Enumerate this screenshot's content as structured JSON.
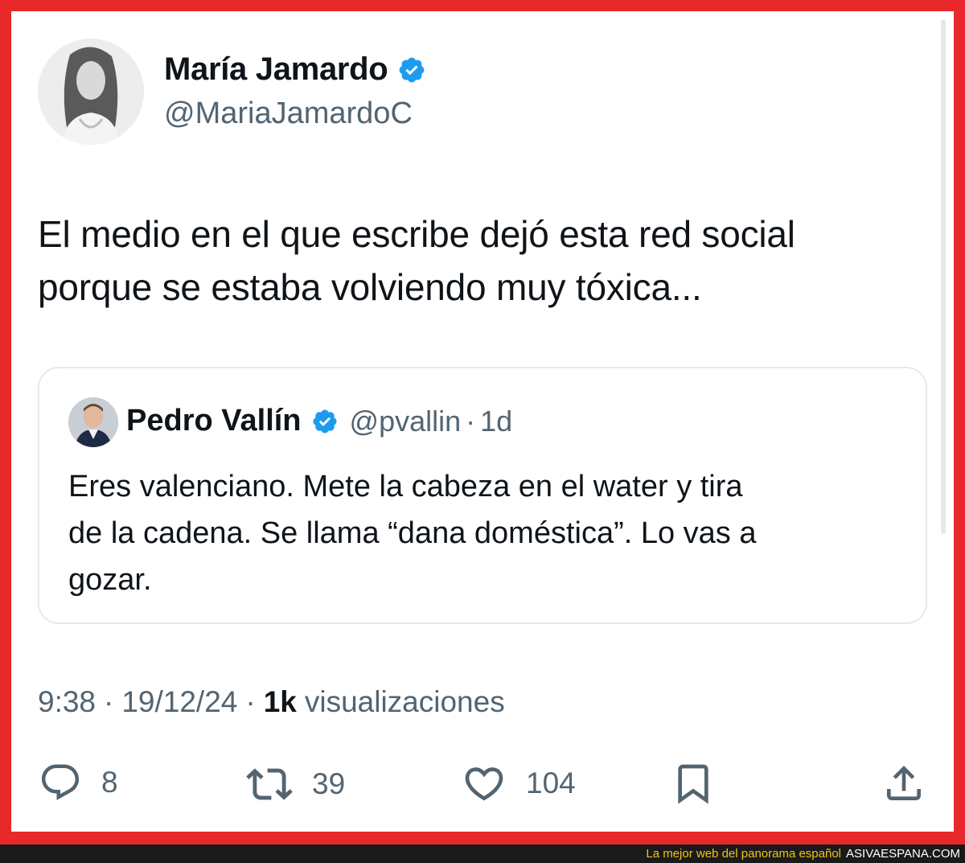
{
  "author": {
    "display_name": "María Jamardo",
    "handle": "@MariaJamardoC"
  },
  "tweet": {
    "text_line1": "El medio en el que escribe dejó esta red social",
    "text_line2": "porque se estaba volviendo muy tóxica..."
  },
  "quoted_tweet": {
    "display_name": "Pedro Vallín",
    "handle": "@pvallin",
    "separator": "·",
    "time": "1d",
    "text_line1": "Eres valenciano. Mete la cabeza en el water y tira",
    "text_line2": "de la cadena. Se llama “dana doméstica”. Lo vas a",
    "text_line3": "gozar."
  },
  "meta": {
    "time": "9:38",
    "separator": "·",
    "date": "19/12/24",
    "views_count": "1k",
    "views_label": "visualizaciones"
  },
  "actions": {
    "replies": "8",
    "reposts": "39",
    "likes": "104"
  },
  "icons": {
    "verified": "verified-badge-icon",
    "reply": "reply-icon",
    "repost": "repost-icon",
    "like": "heart-icon",
    "bookmark": "bookmark-icon",
    "share": "share-icon"
  },
  "footer": {
    "tagline": "La mejor web del panorama español",
    "brand": "ASIVAESPANA.COM"
  },
  "colors": {
    "frame": "#e8282a",
    "verified": "#1d9bf0",
    "text_primary": "#0f1419",
    "text_secondary": "#536471",
    "footer_tagline": "#f0c419"
  }
}
